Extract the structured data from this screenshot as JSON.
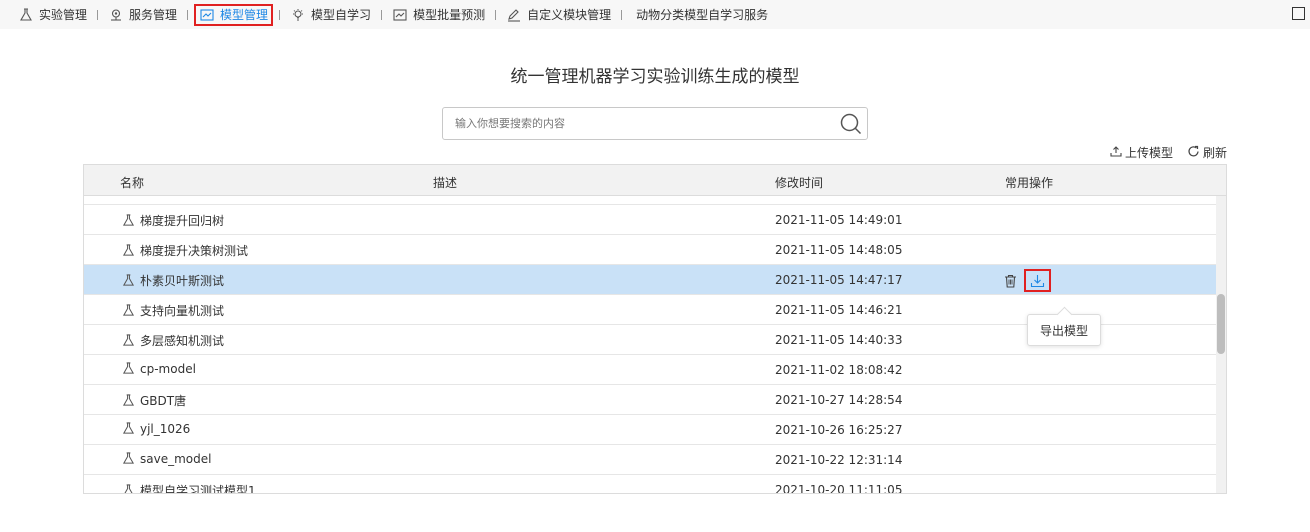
{
  "nav": {
    "items": [
      {
        "label": "实验管理",
        "icon": "flask-icon",
        "active": false
      },
      {
        "label": "服务管理",
        "icon": "map-pin-icon",
        "active": false
      },
      {
        "label": "模型管理",
        "icon": "chart-icon",
        "active": true
      },
      {
        "label": "模型自学习",
        "icon": "bulb-icon",
        "active": false
      },
      {
        "label": "模型批量预测",
        "icon": "chart-icon",
        "active": false
      },
      {
        "label": "自定义模块管理",
        "icon": "edit-icon",
        "active": false
      },
      {
        "label": "动物分类模型自学习服务",
        "icon": "",
        "active": false
      }
    ]
  },
  "page": {
    "title": "统一管理机器学习实验训练生成的模型"
  },
  "search": {
    "placeholder": "输入你想要搜索的内容",
    "value": ""
  },
  "actions": {
    "upload_label": "上传模型",
    "refresh_label": "刷新"
  },
  "table": {
    "columns": {
      "name": "名称",
      "desc": "描述",
      "time": "修改时间",
      "ops": "常用操作"
    },
    "rows": [
      {
        "name": "梯度提升回归树",
        "desc": "",
        "time": "2021-11-05 14:49:01",
        "selected": false
      },
      {
        "name": "梯度提升决策树测试",
        "desc": "",
        "time": "2021-11-05 14:48:05",
        "selected": false
      },
      {
        "name": "朴素贝叶斯测试",
        "desc": "",
        "time": "2021-11-05 14:47:17",
        "selected": true
      },
      {
        "name": "支持向量机测试",
        "desc": "",
        "time": "2021-11-05 14:46:21",
        "selected": false
      },
      {
        "name": "多层感知机测试",
        "desc": "",
        "time": "2021-11-05 14:40:33",
        "selected": false
      },
      {
        "name": "cp-model",
        "desc": "",
        "time": "2021-11-02 18:08:42",
        "selected": false
      },
      {
        "name": "GBDT唐",
        "desc": "",
        "time": "2021-10-27 14:28:54",
        "selected": false
      },
      {
        "name": "yjl_1026",
        "desc": "",
        "time": "2021-10-26 16:25:27",
        "selected": false
      },
      {
        "name": "save_model",
        "desc": "",
        "time": "2021-10-22 12:31:14",
        "selected": false
      },
      {
        "name": "模型自学习测试模型1",
        "desc": "",
        "time": "2021-10-20 11:11:05",
        "selected": false
      }
    ]
  },
  "tooltip": {
    "export_label": "导出模型"
  },
  "colors": {
    "accent": "#1e88e5",
    "highlight": "#e02020",
    "selected_row": "#c9e1f7"
  }
}
